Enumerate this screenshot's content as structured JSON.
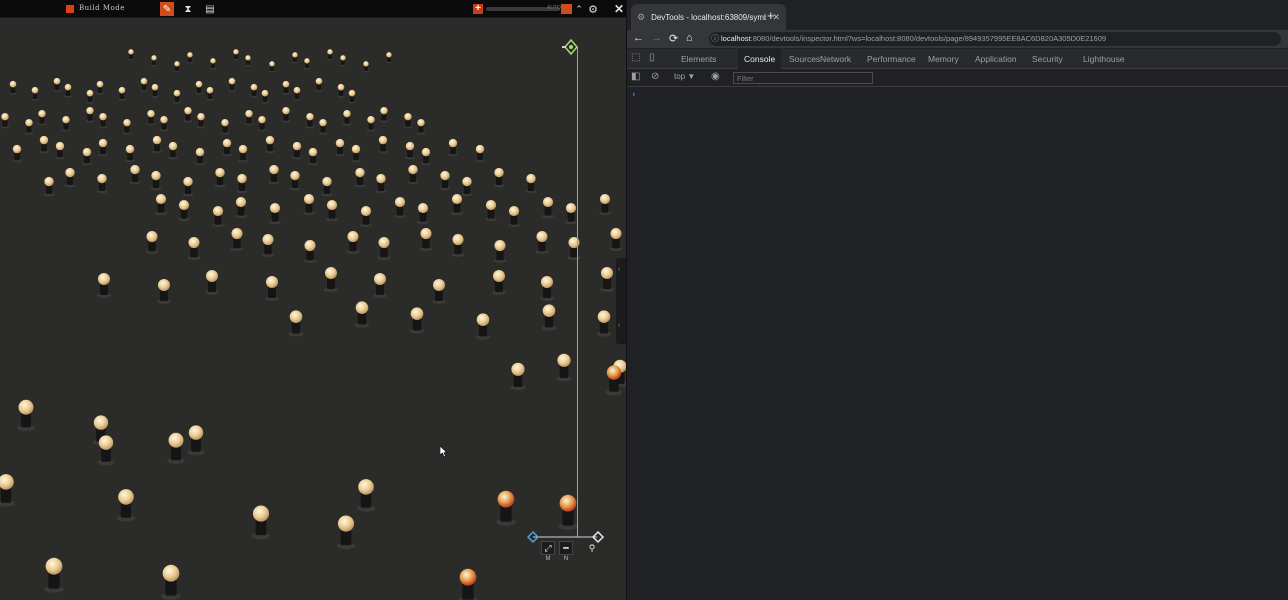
{
  "game": {
    "build_label": "Build Mode",
    "slider_label": "AUTO",
    "gizmo_keys": [
      "M",
      "N"
    ]
  },
  "devtools": {
    "tab_title": "DevTools - localhost:63809/symb",
    "url_host": "localhost",
    "url_rest": ":8080/devtools/inspector.html?ws=localhost:8080/devtools/page/8949357995EE8AC6D820A305D0E21609",
    "tabs": [
      "Elements",
      "Console",
      "Sources",
      "Network",
      "Performance",
      "Memory",
      "Application",
      "Security",
      "Lighthouse"
    ],
    "active_tab": "Console",
    "context": "top ▼",
    "filter_placeholder": "Filter",
    "prompt": "›"
  }
}
